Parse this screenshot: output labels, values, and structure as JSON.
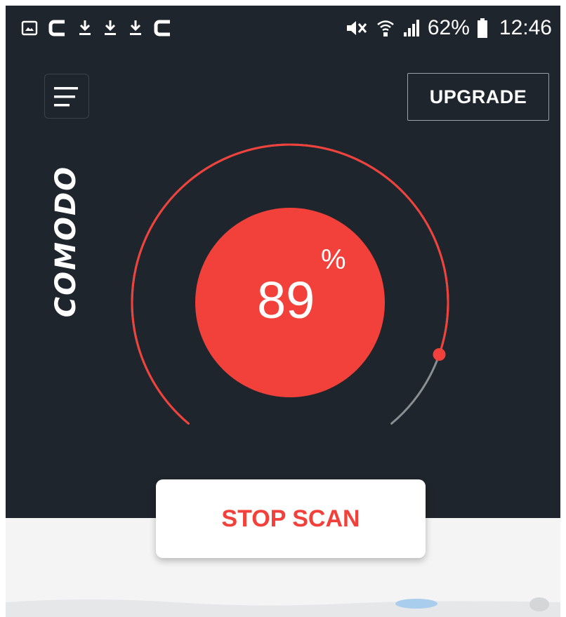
{
  "status_bar": {
    "left_icons": [
      "image-icon",
      "c-app-icon",
      "download-icon",
      "download-icon",
      "download-icon",
      "c-app-icon"
    ],
    "right_icons": [
      "mute-icon",
      "wifi-icon",
      "signal-icon"
    ],
    "battery_percent": "62%",
    "time": "12:46"
  },
  "header": {
    "menu_icon": "hamburger-icon",
    "upgrade_label": "UPGRADE"
  },
  "brand": {
    "logo_text": "COMODO"
  },
  "scan": {
    "progress_value": "89",
    "progress_unit": "%",
    "progress_fraction": 0.89,
    "stop_label": "STOP SCAN"
  },
  "colors": {
    "background": "#1f252c",
    "accent": "#f2413a",
    "track": "#8a8f94",
    "light_panel": "#f4f4f4"
  }
}
